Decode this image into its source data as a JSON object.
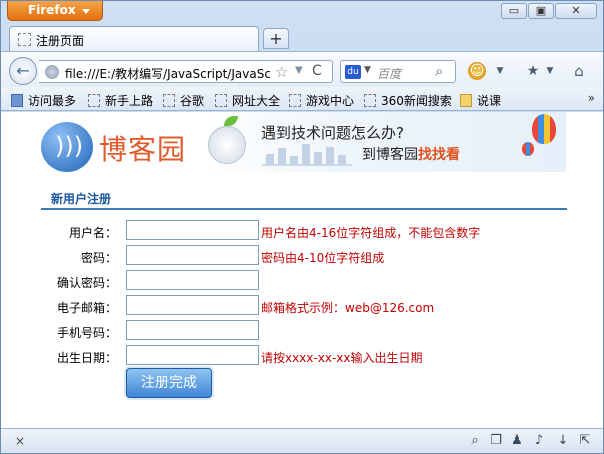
{
  "titlebar": {
    "app_button": "Firefox",
    "min_glyph": "▭",
    "max_glyph": "▣",
    "close_glyph": "✕"
  },
  "tabs": [
    {
      "label": "注册页面"
    }
  ],
  "newtab_glyph": "+",
  "nav": {
    "back_glyph": "←",
    "url": "file:///E:/教材编写/JavaScript/JavaSc",
    "star_glyph": "☆",
    "reload_glyph": "C",
    "search_engine": "du",
    "search_placeholder": "百度",
    "search_glyph": "⌕",
    "icons": [
      "addon-icon",
      "bookmarks-menu-icon",
      "home-icon"
    ]
  },
  "bookmarks": [
    {
      "label": "访问最多",
      "icon": "blue"
    },
    {
      "label": "新手上路",
      "icon": "page"
    },
    {
      "label": "谷歌",
      "icon": "page"
    },
    {
      "label": "网址大全",
      "icon": "page"
    },
    {
      "label": "游戏中心",
      "icon": "page"
    },
    {
      "label": "360新闻搜索",
      "icon": "page"
    },
    {
      "label": "说课",
      "icon": "folder"
    }
  ],
  "bookmarks_more": "»",
  "page": {
    "logo_text": "博客园",
    "banner_line1": "遇到技术问题怎么办?",
    "banner_line2_prefix": "到博客园",
    "banner_line2_highlight": "找找看",
    "section_title": "新用户注册",
    "fields": [
      {
        "label": "用户名：",
        "value": "",
        "hint": "用户名由4-16位字符组成，不能包含数字"
      },
      {
        "label": "密码：",
        "value": "",
        "hint": "密码由4-10位字符组成"
      },
      {
        "label": "确认密码：",
        "value": "",
        "hint": ""
      },
      {
        "label": "电子邮箱：",
        "value": "",
        "hint": "邮箱格式示例：web@126.com"
      },
      {
        "label": "手机号码：",
        "value": "",
        "hint": ""
      },
      {
        "label": "出生日期：",
        "value": "",
        "hint": "请按xxxx-xx-xx输入出生日期"
      }
    ],
    "submit_label": "注册完成"
  },
  "status": {
    "close_glyph": "×",
    "icons": [
      "search-icon",
      "windows-icon",
      "shirt-icon",
      "speaker-icon",
      "download-icon",
      "share-icon"
    ]
  },
  "colors": {
    "accent": "#3f7db8",
    "hint": "#c00000",
    "brand_orange": "#e2700f"
  }
}
